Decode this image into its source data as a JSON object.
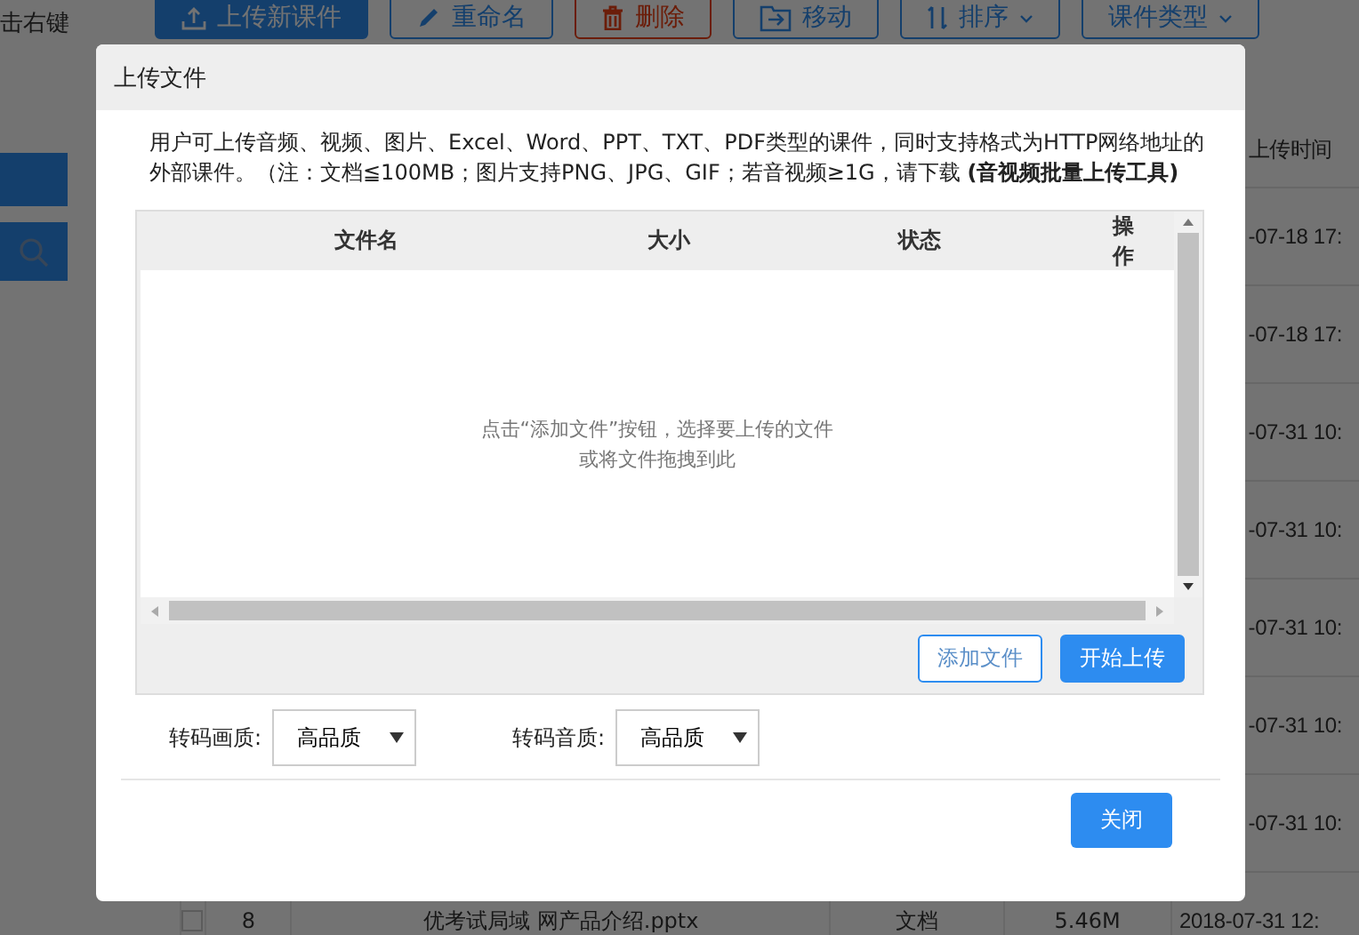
{
  "background": {
    "hint": "击右键",
    "toolbar": [
      {
        "label": "上传新课件",
        "kind": "primary"
      },
      {
        "label": "重命名",
        "kind": "outline"
      },
      {
        "label": "删除",
        "kind": "danger"
      },
      {
        "label": "移动",
        "kind": "outline"
      },
      {
        "label": "排序",
        "kind": "dropdown"
      },
      {
        "label": "课件类型",
        "kind": "dropdown"
      }
    ],
    "table": {
      "columns": [
        "上传时间"
      ],
      "rows": [
        {
          "time": "-07-18 17:"
        },
        {
          "time": "-07-18 17:"
        },
        {
          "time": "-07-31 10:"
        },
        {
          "time": "-07-31 10:"
        },
        {
          "time": "-07-31 10:"
        },
        {
          "time": "-07-31 10:"
        },
        {
          "time": "-07-31 10:"
        },
        {
          "number": "8",
          "checked": false,
          "name": "优考试局域 网产品介绍.pptx",
          "type": "文档",
          "size": "5.46M",
          "time": "2018-07-31 12:"
        }
      ]
    }
  },
  "dialog": {
    "title": "上传文件",
    "description": "用户可上传音频、视频、图片、Excel、Word、PPT、TXT、PDF类型的课件，同时支持格式为HTTP网络地址的外部课件。（注：文档≦100MB；图片支持PNG、JPG、GIF；若音视频≥1G，请下载 **(音视频批量上传工具)**",
    "file_table": {
      "columns": [
        "文件名",
        "大小",
        "状态",
        "操作"
      ],
      "empty_text": [
        "点击“添加文件”按钮，选择要上传的文件",
        "或将文件拖拽到此"
      ]
    },
    "actions": [
      {
        "label": "添加文件",
        "kind": "outline"
      },
      {
        "label": "开始上传",
        "kind": "primary"
      }
    ],
    "options": [
      {
        "label": "转码画质:",
        "value": "高品质"
      },
      {
        "label": "转码音质:",
        "value": "高品质"
      }
    ],
    "close_button": "关闭"
  }
}
